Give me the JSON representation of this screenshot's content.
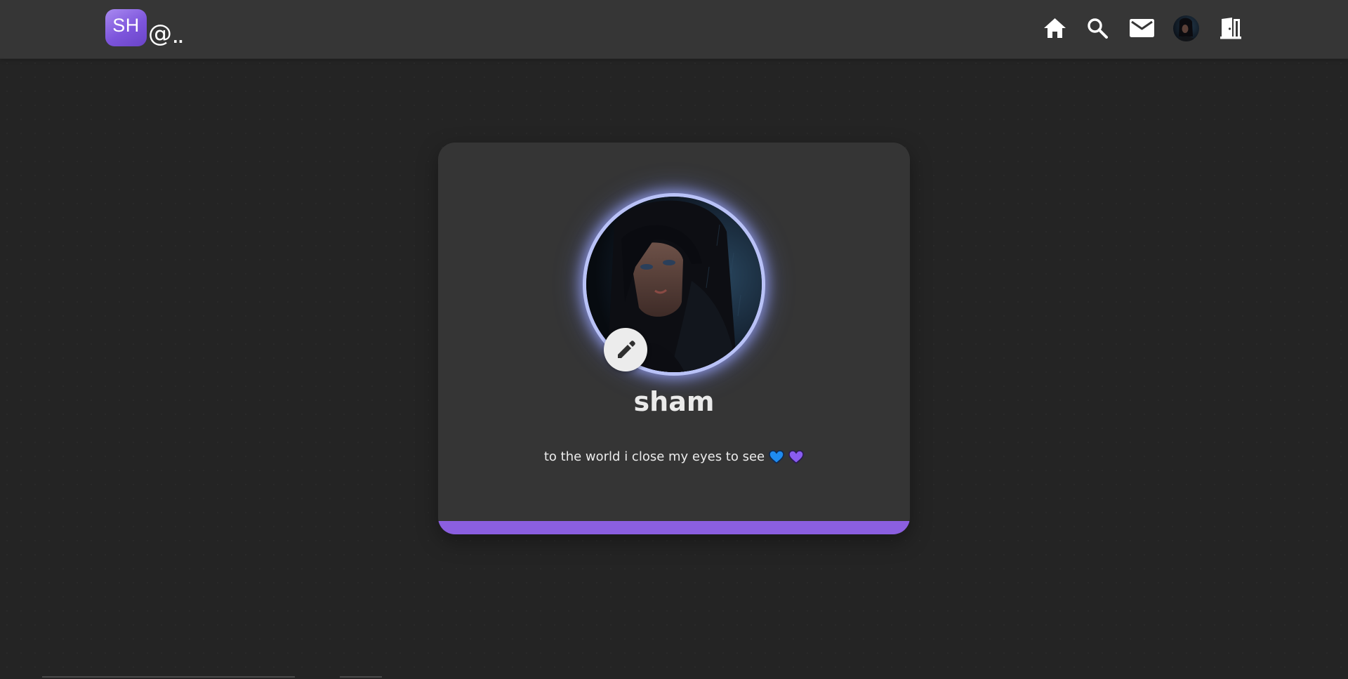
{
  "header": {
    "logo": {
      "badge_text": "SH",
      "at_text": "@",
      "dots_text": ".."
    },
    "nav": [
      {
        "name": "home",
        "icon": "home-icon"
      },
      {
        "name": "search",
        "icon": "search-icon"
      },
      {
        "name": "messages",
        "icon": "mail-icon"
      },
      {
        "name": "profile",
        "icon": "avatar"
      },
      {
        "name": "logout",
        "icon": "door-exit-icon"
      }
    ]
  },
  "profile": {
    "username": "sham",
    "bio": "to the world i close my eyes to see",
    "bio_emojis": [
      "blue-heart-icon",
      "purple-heart-icon"
    ],
    "edit_icon": "pencil-icon"
  },
  "colors": {
    "accent": "#8b5fe0",
    "background": "#242424",
    "card": "#353535",
    "topbar": "#363636",
    "avatar_glow": "#b9c2f7",
    "blue_heart": "#1f8bf0",
    "purple_heart": "#8a5cf0"
  }
}
